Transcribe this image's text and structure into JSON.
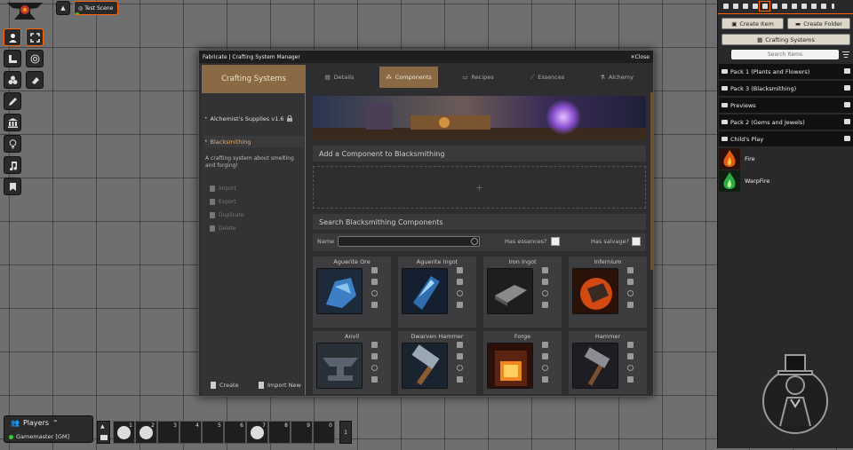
{
  "scene": {
    "tab_label": "Test Scene"
  },
  "window": {
    "title": "Fabricate | Crafting System Manager",
    "close_label": "Close"
  },
  "left_panel": {
    "title": "Crafting Systems",
    "systems": [
      {
        "label": "Alchemist's Supplies v1.6"
      },
      {
        "label": "Blacksmithing"
      }
    ],
    "description": "A crafting system about smelting and forging!",
    "actions": [
      {
        "label": "Import"
      },
      {
        "label": "Export"
      },
      {
        "label": "Duplicate"
      },
      {
        "label": "Delete"
      }
    ],
    "create_label": "Create",
    "import_new_label": "Import New"
  },
  "tabs": [
    {
      "label": "Details",
      "icon": "file-icon"
    },
    {
      "label": "Components",
      "icon": "cubes-icon"
    },
    {
      "label": "Recipes",
      "icon": "scroll-icon"
    },
    {
      "label": "Essences",
      "icon": "mortar-icon"
    },
    {
      "label": "Alchemy",
      "icon": "flask-icon"
    }
  ],
  "active_tab": "Components",
  "content": {
    "add_heading": "Add a Component to Blacksmithing",
    "dropzone_symbol": "+",
    "search_heading": "Search Blacksmithing Components",
    "name_label": "Name",
    "name_value": "",
    "has_essences_label": "Has essences?",
    "has_salvage_label": "Has salvage?",
    "components": [
      {
        "name": "Aguerite Ore"
      },
      {
        "name": "Aguerite Ingot"
      },
      {
        "name": "Iron Ingot"
      },
      {
        "name": "Infernium"
      },
      {
        "name": "Anvil"
      },
      {
        "name": "Dwarven Hammer"
      },
      {
        "name": "Forge"
      },
      {
        "name": "Hammer"
      }
    ]
  },
  "sidebar": {
    "create_item": "Create Item",
    "create_folder": "Create Folder",
    "crafting_systems": "Crafting Systems",
    "search_placeholder": "Search Items",
    "folders": [
      {
        "label": "Pack 1 (Plants and Flowers)"
      },
      {
        "label": "Pack 3 (Blacksmithing)"
      },
      {
        "label": "Previews"
      },
      {
        "label": "Pack 2 (Gems and Jewels)"
      },
      {
        "label": "Child's Play"
      }
    ],
    "items": [
      {
        "label": "Fire"
      },
      {
        "label": "WarpFire"
      }
    ]
  },
  "players": {
    "title": "Players",
    "gm": "Gamemaster [GM]"
  },
  "hotbar": {
    "slots": [
      "1",
      "2",
      "3",
      "4",
      "5",
      "6",
      "7",
      "8",
      "9",
      "0"
    ],
    "page": "1"
  },
  "colors": {
    "accent": "#ff6400",
    "tab_active": "#8a6a44",
    "selected_text": "#e9a96b"
  }
}
